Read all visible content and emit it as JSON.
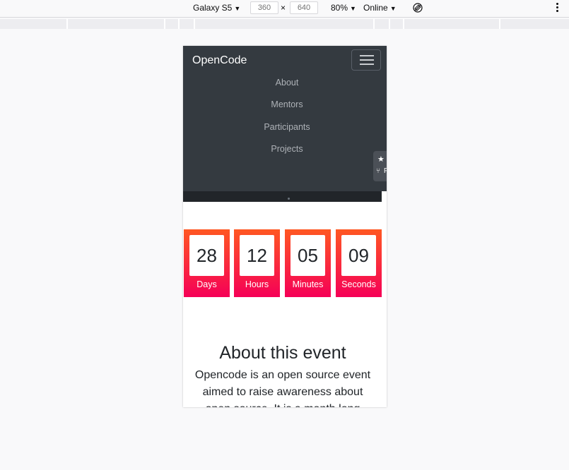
{
  "devtools": {
    "device": "Galaxy S5",
    "width": "360",
    "height": "640",
    "times": "×",
    "zoom": "80%",
    "network": "Online",
    "caret": "▼",
    "icons": [
      "rotate-icon",
      "kebab-menu-icon"
    ]
  },
  "site": {
    "brand": "OpenCode",
    "nav": [
      {
        "label": "About"
      },
      {
        "label": "Mentors"
      },
      {
        "label": "Participants"
      },
      {
        "label": "Projects"
      }
    ],
    "badge": {
      "star": "★",
      "fork": "⑂",
      "fork_text": "F"
    },
    "countdown": [
      {
        "value": "28",
        "label": "Days"
      },
      {
        "value": "12",
        "label": "Hours"
      },
      {
        "value": "05",
        "label": "Minutes"
      },
      {
        "value": "09",
        "label": "Seconds"
      }
    ],
    "about": {
      "title": "About this event",
      "text": "Opencode is an open source event aimed to raise awareness about open source. It is a month long event"
    },
    "colors": {
      "navbar": "#343a40",
      "gradient_top": "#ff5722",
      "gradient_bottom": "#f50057"
    }
  }
}
